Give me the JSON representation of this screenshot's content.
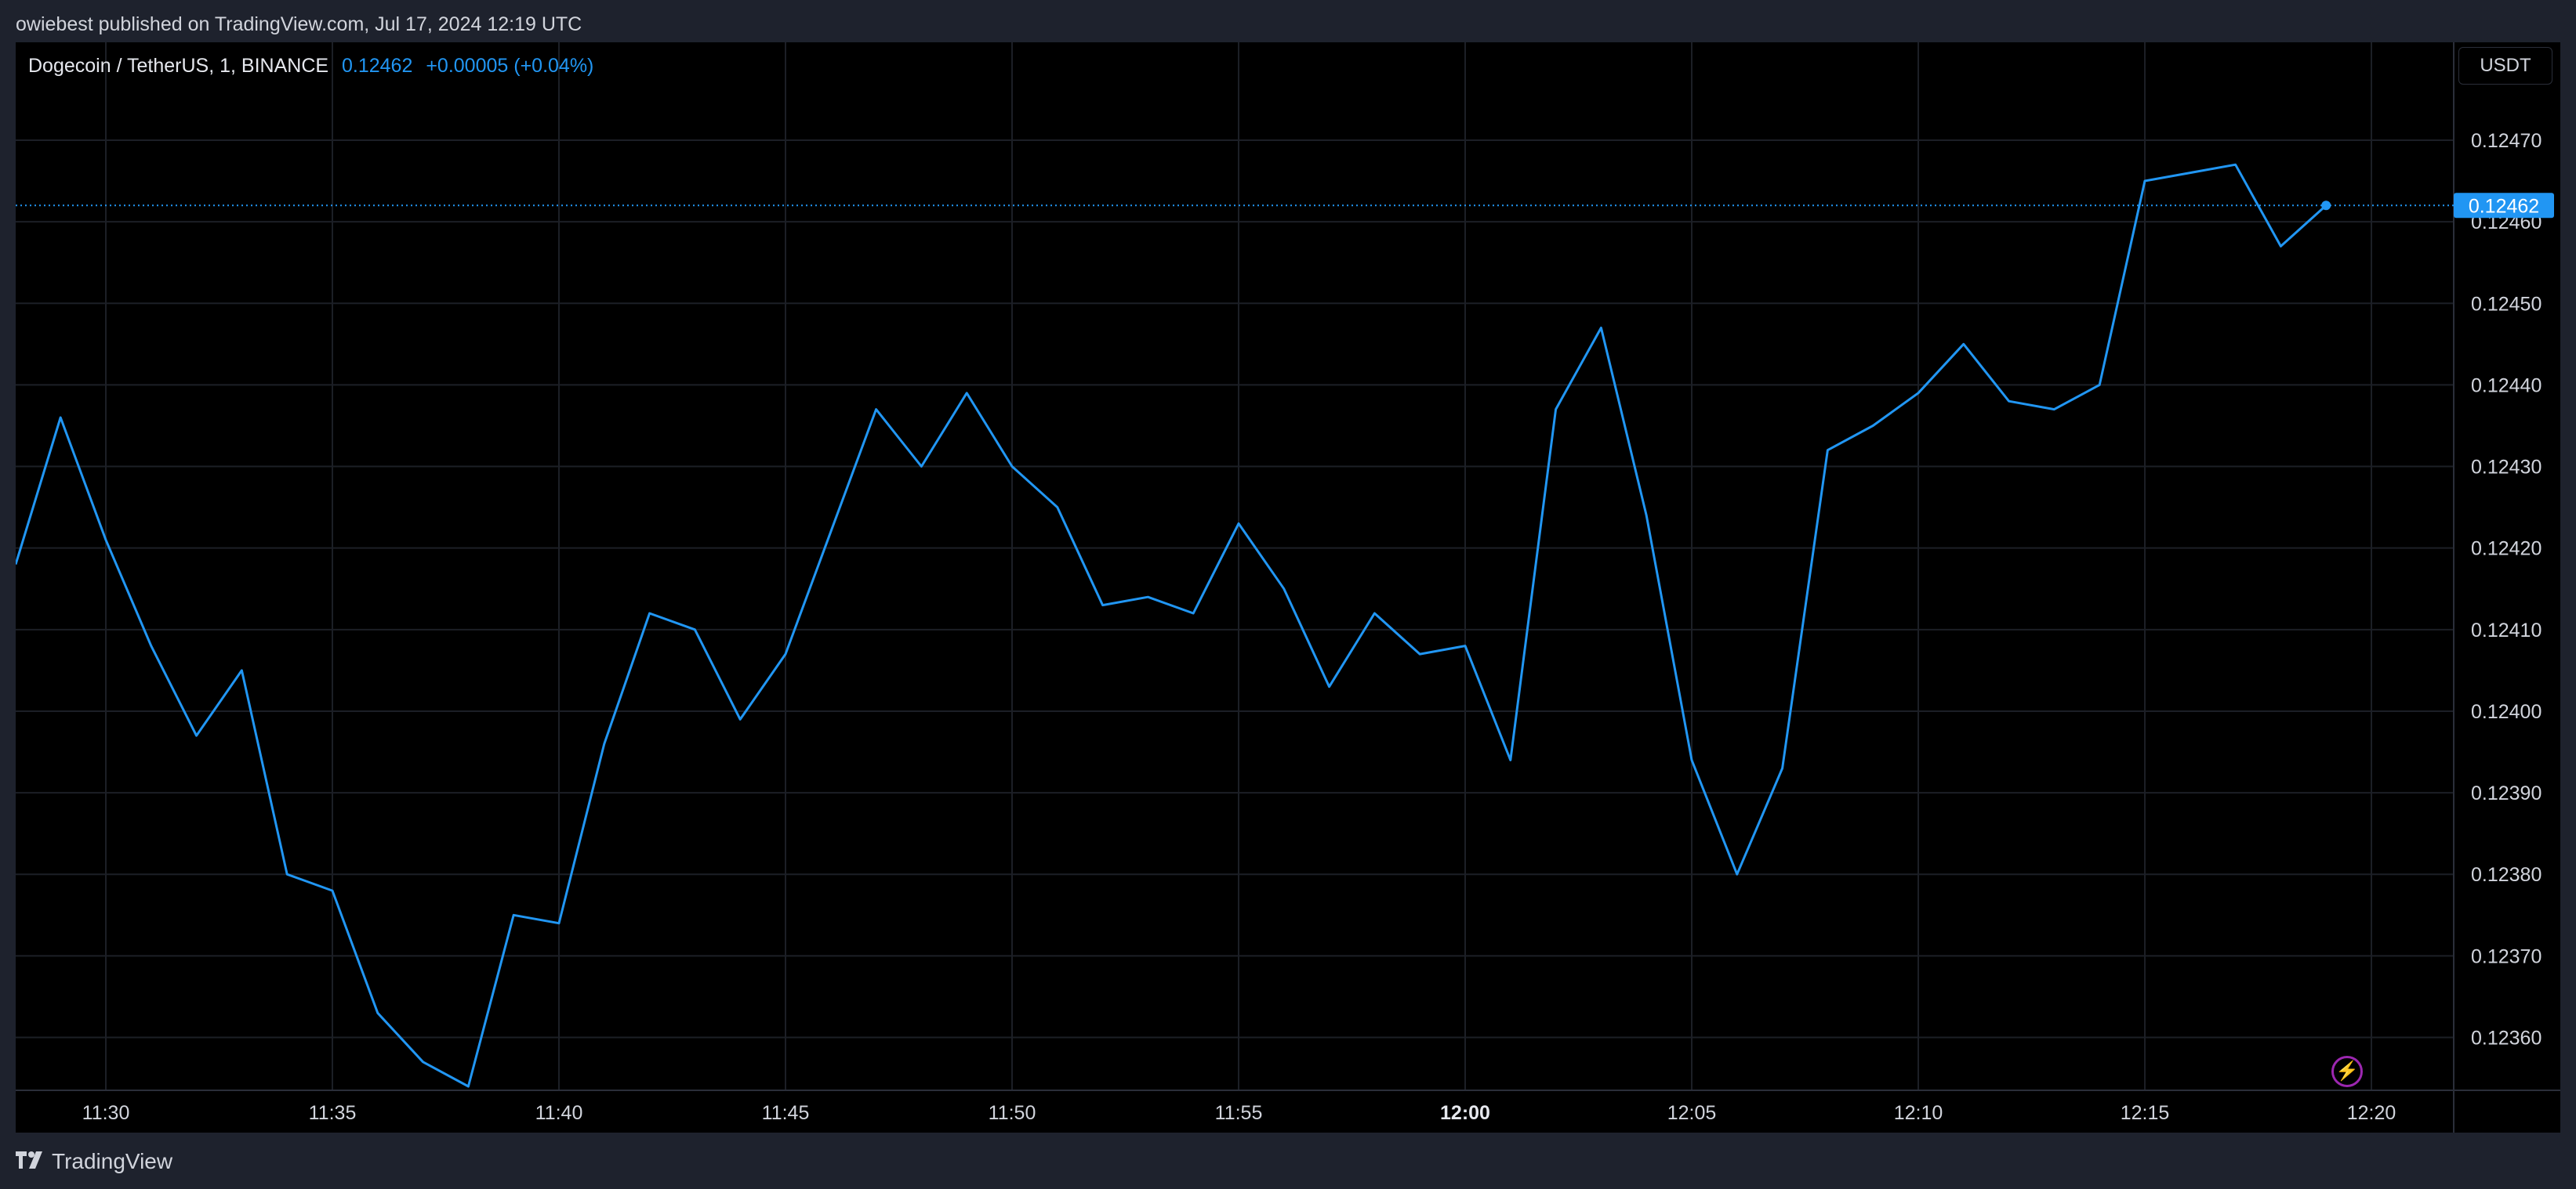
{
  "header": {
    "published_text": "owiebest published on TradingView.com, Jul 17, 2024 12:19 UTC"
  },
  "legend": {
    "symbol": "Dogecoin / TetherUS, 1, BINANCE",
    "last_price": "0.12462",
    "change": "+0.00005 (+0.04%)"
  },
  "currency_button": "USDT",
  "footer": {
    "brand": "TradingView"
  },
  "colors": {
    "line": "#2196f3",
    "background": "#000000",
    "grid": "#1c1f26",
    "axis_text": "#d1d4dc"
  },
  "chart_data": {
    "type": "line",
    "ylim": [
      0.12354,
      0.12482
    ],
    "y_ticks": [
      "0.12470",
      "0.12460",
      "0.12450",
      "0.12440",
      "0.12430",
      "0.12420",
      "0.12410",
      "0.12400",
      "0.12390",
      "0.12380",
      "0.12370",
      "0.12360"
    ],
    "x_ticks": [
      "11:30",
      "11:35",
      "11:40",
      "11:45",
      "11:50",
      "11:55",
      "12:00",
      "12:05",
      "12:10",
      "12:15",
      "12:20"
    ],
    "x_ticks_bold": [
      "12:00"
    ],
    "last_price_label": "0.12462",
    "series": [
      {
        "x": [
          "11:28",
          "11:29",
          "11:30",
          "11:31",
          "11:32",
          "11:33",
          "11:34",
          "11:35",
          "11:36",
          "11:37",
          "11:38",
          "11:39",
          "11:40",
          "11:41",
          "11:42",
          "11:43",
          "11:44",
          "11:45",
          "11:46",
          "11:47",
          "11:48",
          "11:49",
          "11:50",
          "11:51",
          "11:52",
          "11:53",
          "11:54",
          "11:55",
          "11:56",
          "11:57",
          "11:58",
          "11:59",
          "12:00",
          "12:01",
          "12:02",
          "12:03",
          "12:04",
          "12:05",
          "12:06",
          "12:07",
          "12:08",
          "12:09",
          "12:10",
          "12:11",
          "12:12",
          "12:13",
          "12:14",
          "12:15",
          "12:16",
          "12:17",
          "12:18",
          "12:19"
        ],
        "values": [
          0.12418,
          0.12436,
          0.12421,
          0.12408,
          0.12397,
          0.12405,
          0.1238,
          0.12378,
          0.12363,
          0.12357,
          0.12354,
          0.12375,
          0.12374,
          0.12396,
          0.12412,
          0.1241,
          0.12399,
          0.12407,
          0.12422,
          0.12437,
          0.1243,
          0.12439,
          0.1243,
          0.12425,
          0.12413,
          0.12414,
          0.12412,
          0.12423,
          0.12415,
          0.12403,
          0.12412,
          0.12407,
          0.12408,
          0.12394,
          0.12437,
          0.12447,
          0.12424,
          0.12394,
          0.1238,
          0.12393,
          0.12432,
          0.12435,
          0.12439,
          0.12445,
          0.12438,
          0.12437,
          0.1244,
          0.12465,
          0.12466,
          0.12467,
          0.12457,
          0.12462
        ]
      }
    ]
  }
}
